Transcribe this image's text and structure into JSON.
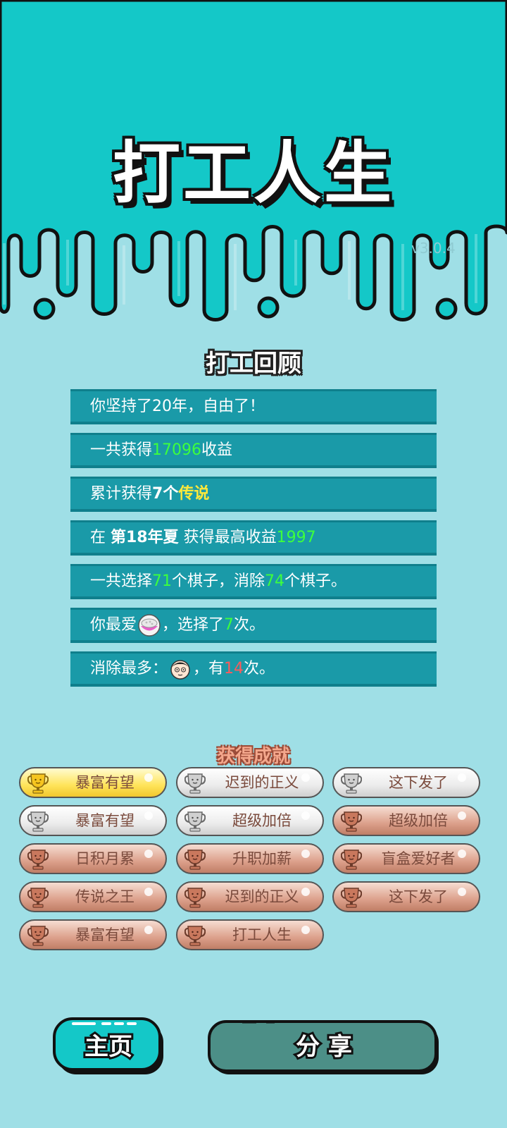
{
  "app": {
    "title": "打工人生",
    "version": "v3.0.4"
  },
  "review": {
    "title": "打工回顾",
    "rows": [
      {
        "a": "你坚持了20年，自由了！"
      },
      {
        "a": "一共获得",
        "b": "17096",
        "c": "收益"
      },
      {
        "a": "累计获得",
        "b": "7个",
        "c": "传说"
      },
      {
        "a": "在 ",
        "b": "第18年夏",
        "c": " 获得最高收益",
        "d": "1997"
      },
      {
        "a": "一共选择",
        "b": "71",
        "c": "个棋子，消除",
        "d": "74",
        "e": "个棋子。"
      },
      {
        "a": "你最爱",
        "icon": "rice-bowl-icon",
        "c": "，选择了",
        "d": "7",
        "e": "次。"
      },
      {
        "a": "消除最多：",
        "icon": "face-icon",
        "c": "，有",
        "d": "14",
        "e": "次。"
      }
    ]
  },
  "achievements": {
    "title": "获得成就",
    "items": [
      {
        "label": "暴富有望",
        "tier": "gold"
      },
      {
        "label": "迟到的正义",
        "tier": "silver"
      },
      {
        "label": "这下发了",
        "tier": "silver"
      },
      {
        "label": "暴富有望",
        "tier": "silver"
      },
      {
        "label": "超级加倍",
        "tier": "silver"
      },
      {
        "label": "超级加倍",
        "tier": "bronze"
      },
      {
        "label": "日积月累",
        "tier": "bronze"
      },
      {
        "label": "升职加薪",
        "tier": "bronze"
      },
      {
        "label": "盲盒爱好者",
        "tier": "bronze"
      },
      {
        "label": "传说之王",
        "tier": "bronze"
      },
      {
        "label": "迟到的正义",
        "tier": "bronze"
      },
      {
        "label": "这下发了",
        "tier": "bronze"
      },
      {
        "label": "暴富有望",
        "tier": "bronze"
      },
      {
        "label": "打工人生",
        "tier": "bronze"
      }
    ]
  },
  "buttons": {
    "home": "主页",
    "share": "分 享"
  },
  "colors": {
    "top_bg": "#14c8c8",
    "bottom_bg": "#9fdfe6",
    "row_bg": "#1a9aa8",
    "green": "#3dff3d",
    "yellow": "#ffe93a",
    "red": "#ff5a5a"
  }
}
